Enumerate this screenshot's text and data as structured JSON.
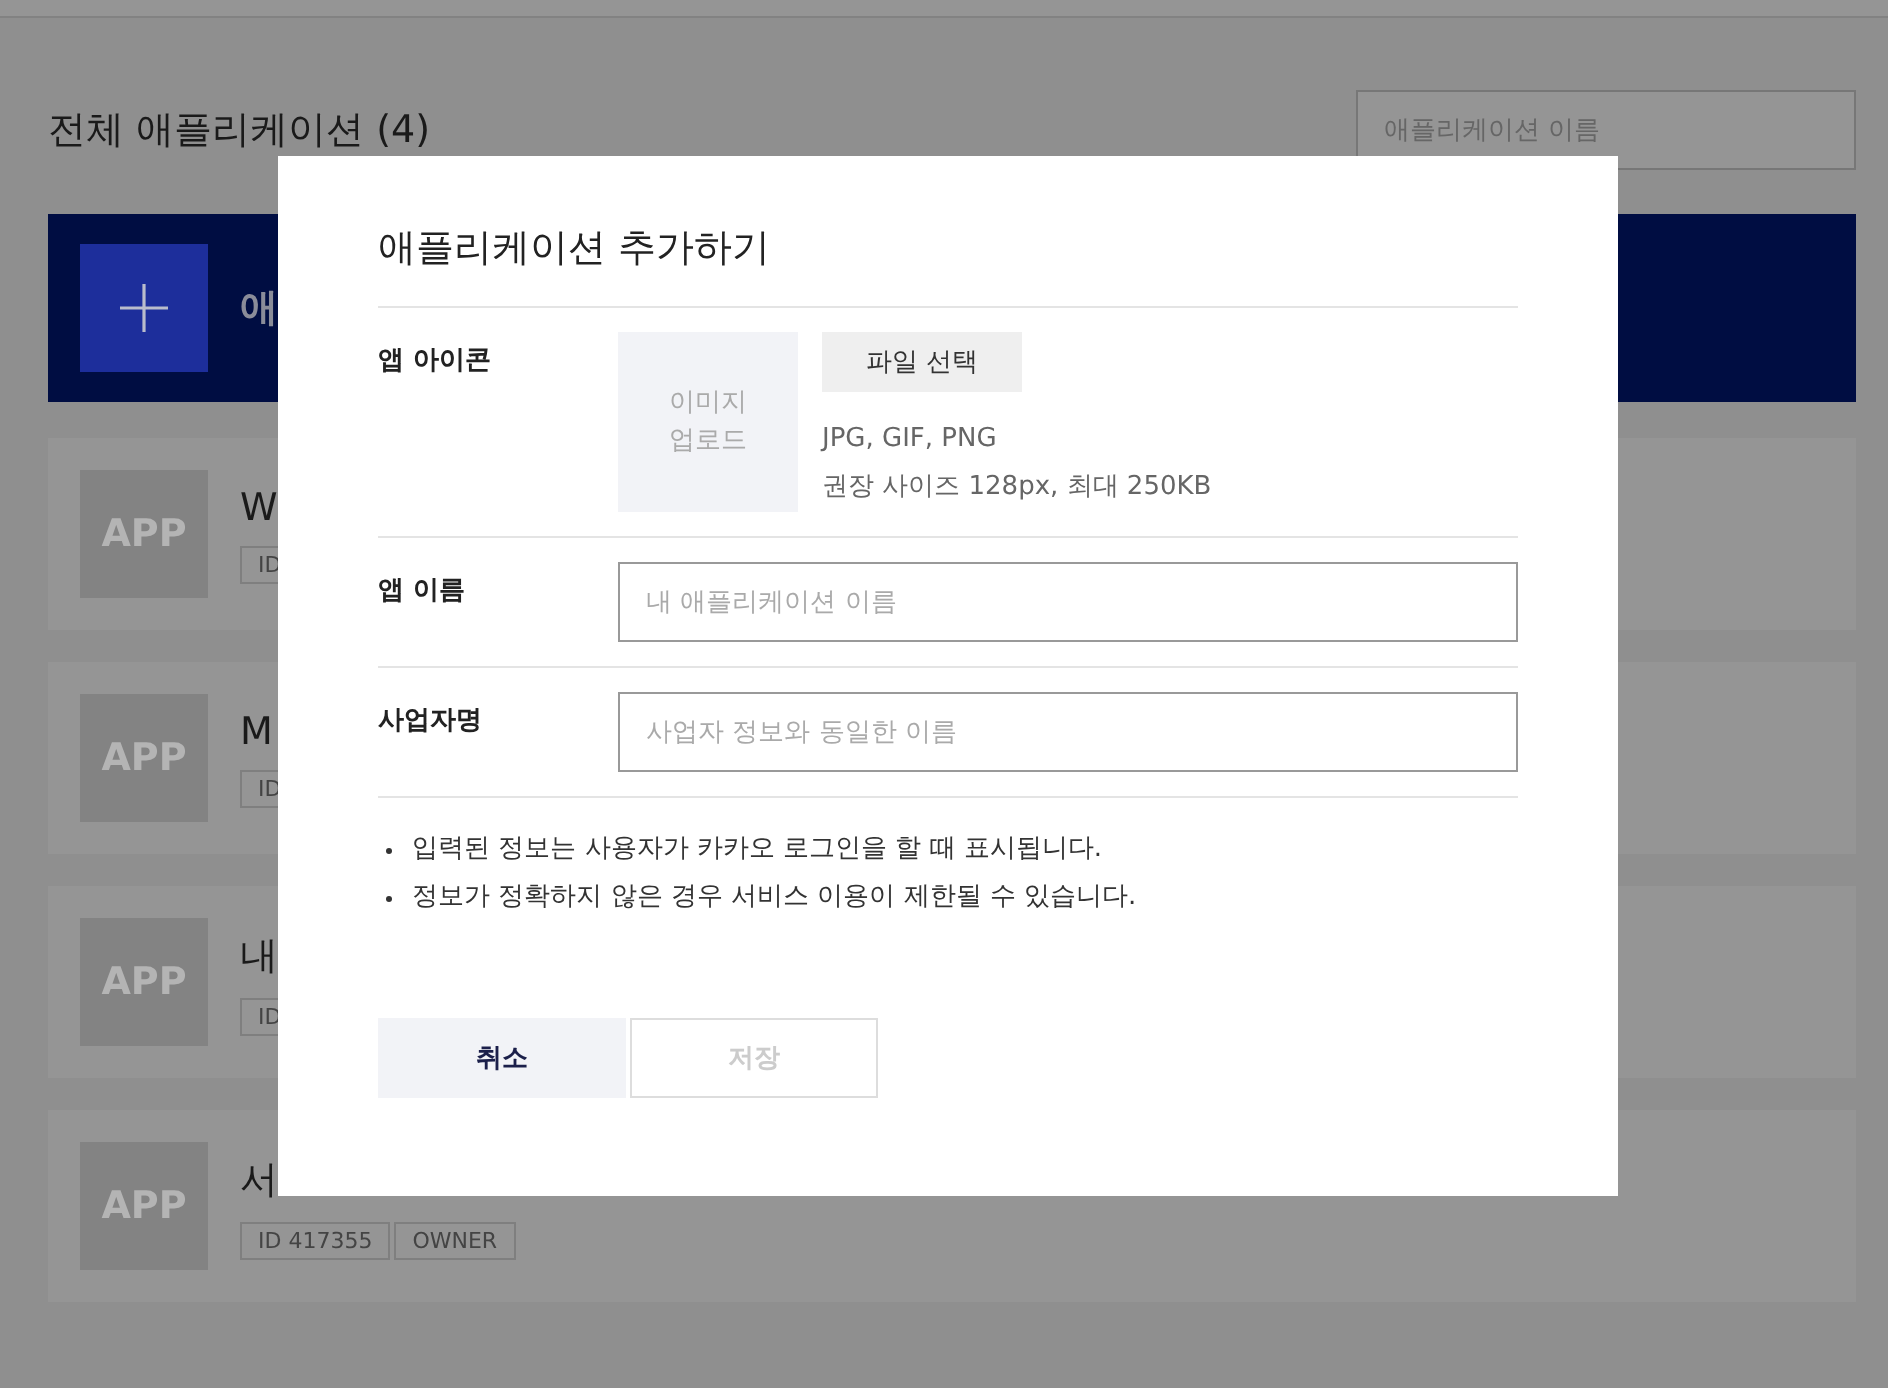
{
  "page": {
    "title": "전체 애플리케이션 (4)",
    "search": {
      "placeholder": "애플리케이션 이름"
    },
    "add_banner": {
      "label": "애"
    },
    "apps": [
      {
        "icon_text": "APP",
        "name": "W",
        "badges": [
          "ID"
        ]
      },
      {
        "icon_text": "APP",
        "name": "M",
        "badges": [
          "ID"
        ]
      },
      {
        "icon_text": "APP",
        "name": "내",
        "badges": [
          "ID"
        ]
      },
      {
        "icon_text": "APP",
        "name": "서",
        "badges": [
          "ID 417355",
          "OWNER"
        ]
      }
    ]
  },
  "modal": {
    "title": "애플리케이션 추가하기",
    "fields": [
      {
        "kind": "icon",
        "label": "앱 아이콘",
        "upload_lines": [
          "이미지",
          "업로드"
        ],
        "button": "파일 선택",
        "hints": [
          "JPG, GIF, PNG",
          "권장 사이즈 128px, 최대 250KB"
        ]
      },
      {
        "kind": "text",
        "label": "앱 이름",
        "placeholder": "내 애플리케이션 이름"
      },
      {
        "kind": "text",
        "label": "사업자명",
        "placeholder": "사업자 정보와 동일한 이름"
      }
    ],
    "notes": [
      "입력된 정보는 사용자가 카카오 로그인을 할 때 표시됩니다.",
      "정보가 정확하지 않은 경우 서비스 이용이 제한될 수 있습니다."
    ],
    "buttons": [
      {
        "label": "취소",
        "disabled": false
      },
      {
        "label": "저장",
        "disabled": true
      }
    ]
  }
}
